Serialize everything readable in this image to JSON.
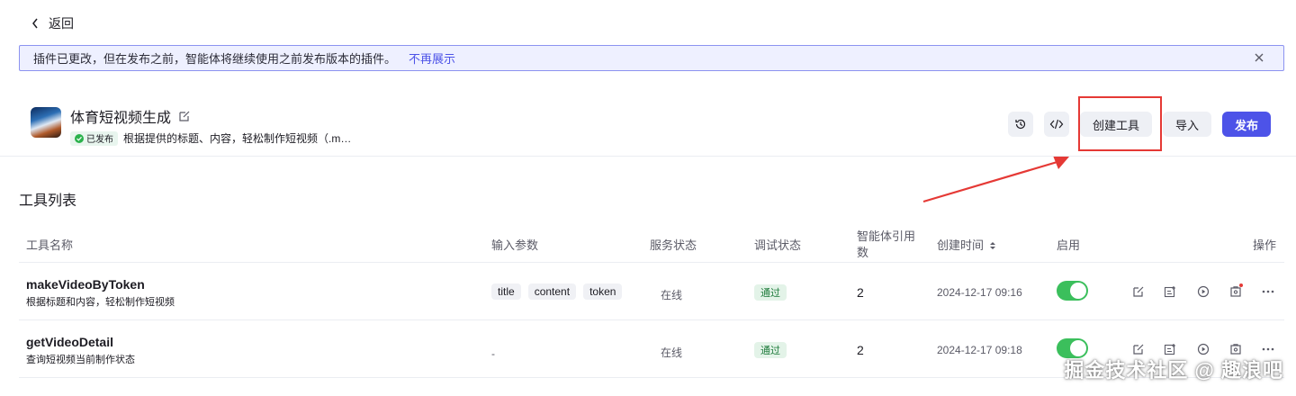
{
  "nav": {
    "back_label": "返回"
  },
  "banner": {
    "text": "插件已更改，但在发布之前，智能体将继续使用之前发布版本的插件。",
    "link": "不再展示"
  },
  "plugin": {
    "title": "体育短视频生成",
    "status": "已发布",
    "description": "根据提供的标题、内容，轻松制作短视频（.m…"
  },
  "toolbar": {
    "create_label": "创建工具",
    "import_label": "导入",
    "publish_label": "发布"
  },
  "section": {
    "title": "工具列表"
  },
  "table": {
    "headers": {
      "name": "工具名称",
      "params": "输入参数",
      "service": "服务状态",
      "debug": "调试状态",
      "refs_line1": "智能体引用",
      "refs_line2": "数",
      "created": "创建时间",
      "enabled": "启用",
      "actions": "操作"
    },
    "rows": [
      {
        "name": "makeVideoByToken",
        "desc": "根据标题和内容，轻松制作短视频",
        "params": [
          "title",
          "content",
          "token"
        ],
        "service": "在线",
        "debug": "通过",
        "refs": "2",
        "created": "2024-12-17 09:16",
        "enabled": true
      },
      {
        "name": "getVideoDetail",
        "desc": "查询短视频当前制作状态",
        "params_empty": "-",
        "service": "在线",
        "debug": "通过",
        "refs": "2",
        "created": "2024-12-17 09:18",
        "enabled": true
      }
    ]
  },
  "watermark": "掘金技术社区 @ 趣浪吧",
  "colors": {
    "primary": "#4d53e8",
    "toggle_on": "#3bbf5c",
    "highlight": "#e53935"
  }
}
